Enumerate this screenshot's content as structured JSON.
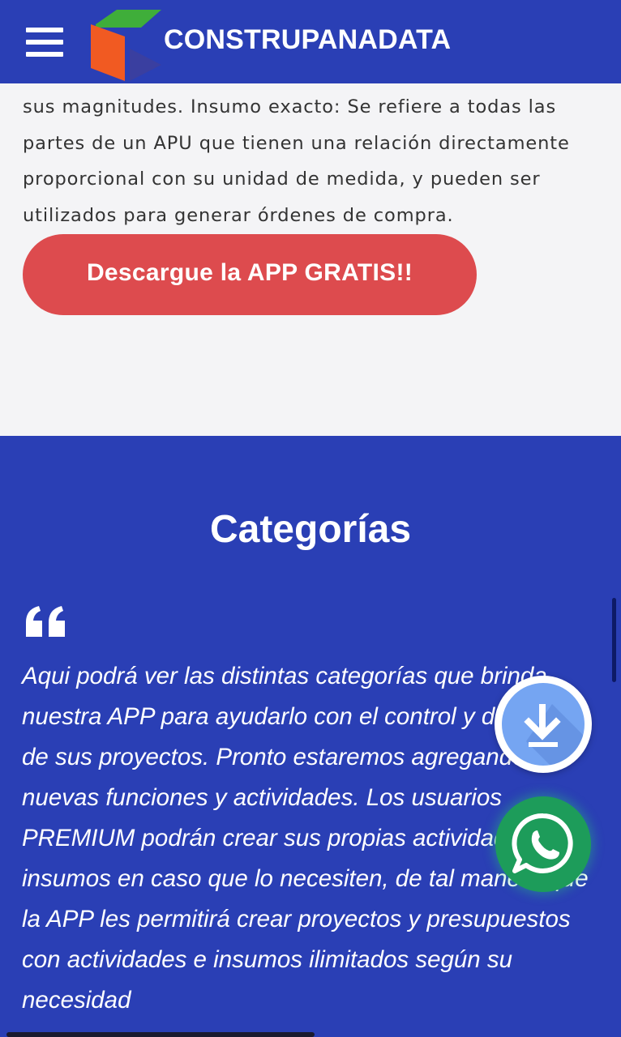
{
  "header": {
    "brand": "CONSTRUPANADATA"
  },
  "intro": {
    "text": "sus magnitudes. Insumo exacto: Se refiere a todas las partes de un APU que tienen una relación directamente proporcional con su unidad de medida, y pueden ser utilizados para generar órdenes de compra."
  },
  "cta": {
    "label": "Descargue la APP GRATIS!!"
  },
  "categories": {
    "title": "Categorías",
    "quote": "Aqui podrá ver las distintas categorías que brinda nuestra APP para ayudarlo con el control y desarrollo de sus proyectos. Pronto estaremos agregando nuevas funciones y actividades. Los usuarios PREMIUM podrán crear sus propias actividades e insumos en caso que lo necesiten, de tal manera que la APP les permitirá crear proyectos y presupuestos con actividades e insumos ilimitados según su necesidad"
  },
  "icons": {
    "menu": "hamburger-menu-icon",
    "logo": "cube-logo-icon",
    "quote": "quote-icon",
    "download": "download-icon",
    "whatsapp": "whatsapp-icon"
  },
  "colors": {
    "primary": "#2a3fb5",
    "cta": "#dd4b4e",
    "background": "#f4f4f6",
    "download_fab": "#75a5f2",
    "whatsapp_fab": "#1d9c5a"
  }
}
